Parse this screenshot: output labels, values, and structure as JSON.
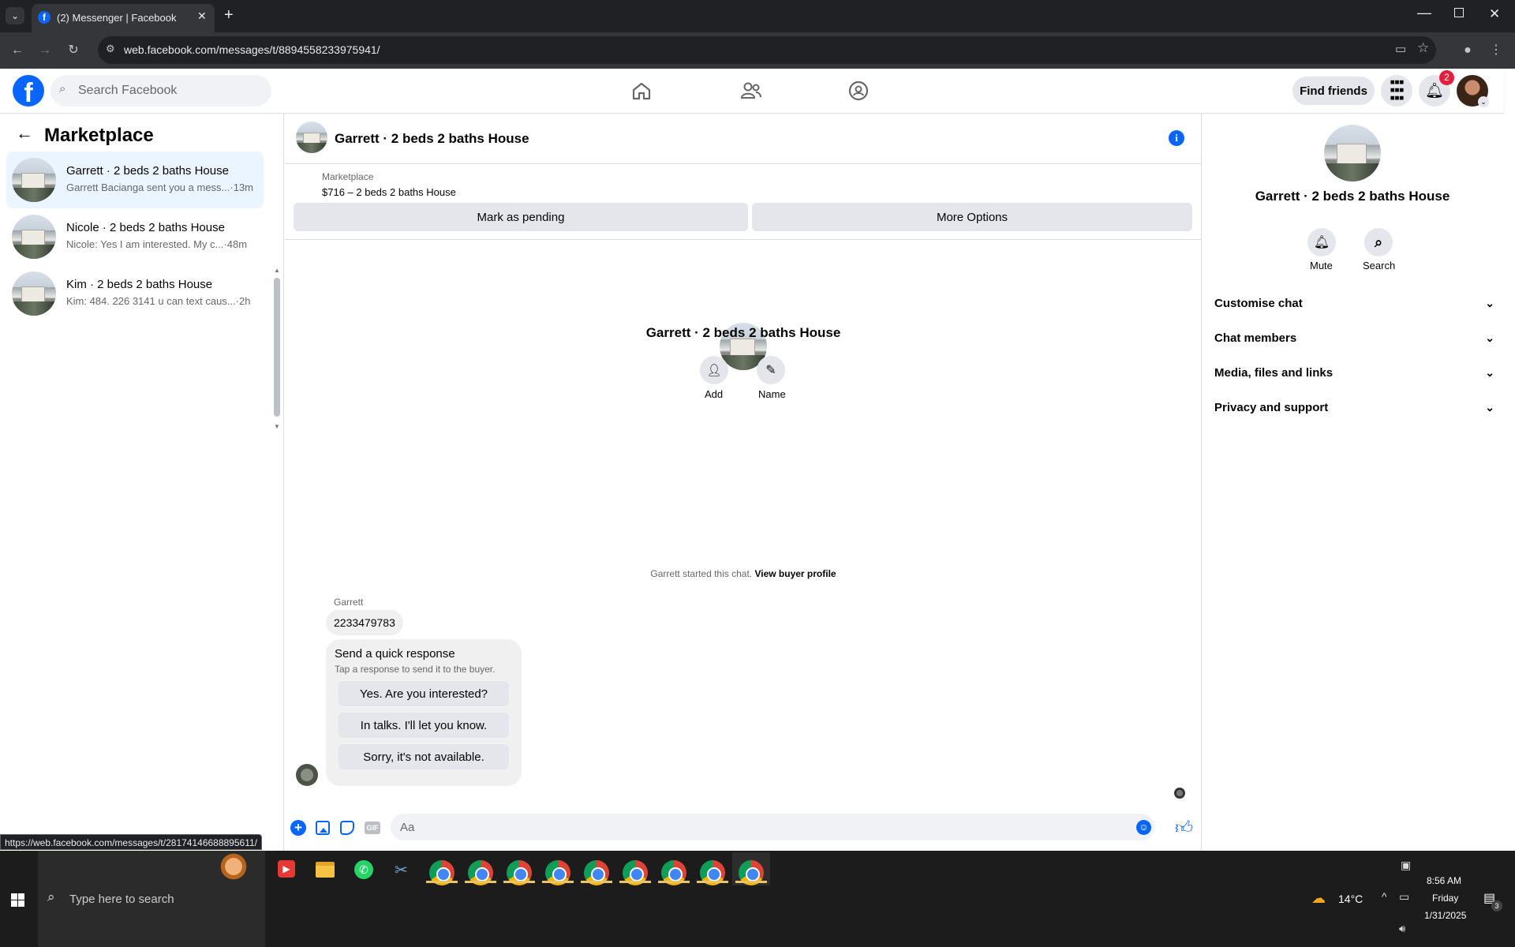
{
  "browser": {
    "tab_title": "(2) Messenger | Facebook",
    "url": "web.facebook.com/messages/t/8894558233975941/",
    "status_url": "https://web.facebook.com/messages/t/28174146688895611/"
  },
  "header": {
    "search_placeholder": "Search Facebook",
    "find_friends": "Find friends",
    "notif_count": "2"
  },
  "sidebar": {
    "title": "Marketplace",
    "conversations": [
      {
        "title": "Garrett · 2 beds 2 baths House",
        "snippet": "Garrett Baciangа sent you a mess...",
        "time": "·13m"
      },
      {
        "title": "Nicole · 2 beds 2 baths House",
        "snippet": "Nicole: Yes I am interested. My c...",
        "time": "·48m"
      },
      {
        "title": "Kim · 2 beds 2 baths House",
        "snippet": "Kim: 484. 226 3141 u can text caus...",
        "time": "·2h"
      }
    ]
  },
  "chat": {
    "title": "Garrett · 2 beds 2 baths House",
    "listing_label": "Marketplace",
    "listing_price": "$716 – 2 beds 2 baths House",
    "mark_pending": "Mark as pending",
    "more_options": "More Options",
    "profile_name": "Garrett · 2 beds 2 baths House",
    "add_label": "Add",
    "name_label": "Name",
    "started_text": "Garrett started this chat.",
    "view_buyer": "View buyer profile",
    "sender": "Garrett",
    "message": "2233479783",
    "quick_title": "Send a quick response",
    "quick_sub": "Tap a response to send it to the buyer.",
    "quick_responses": [
      "Yes. Are you interested?",
      "In talks. I'll let you know.",
      "Sorry, it's not available."
    ],
    "composer_placeholder": "Aa"
  },
  "details": {
    "name": "Garrett · 2 beds 2 baths House",
    "mute": "Mute",
    "search": "Search",
    "sections": [
      "Customise chat",
      "Chat members",
      "Media, files and links",
      "Privacy and support"
    ]
  },
  "taskbar": {
    "search_placeholder": "Type here to search",
    "temperature": "14°C",
    "time": "8:56 AM",
    "day": "Friday",
    "date": "1/31/2025",
    "notif_count": "3"
  },
  "colors": {
    "brand_blue": "#0866ff",
    "notif_red": "#e41e3f"
  }
}
